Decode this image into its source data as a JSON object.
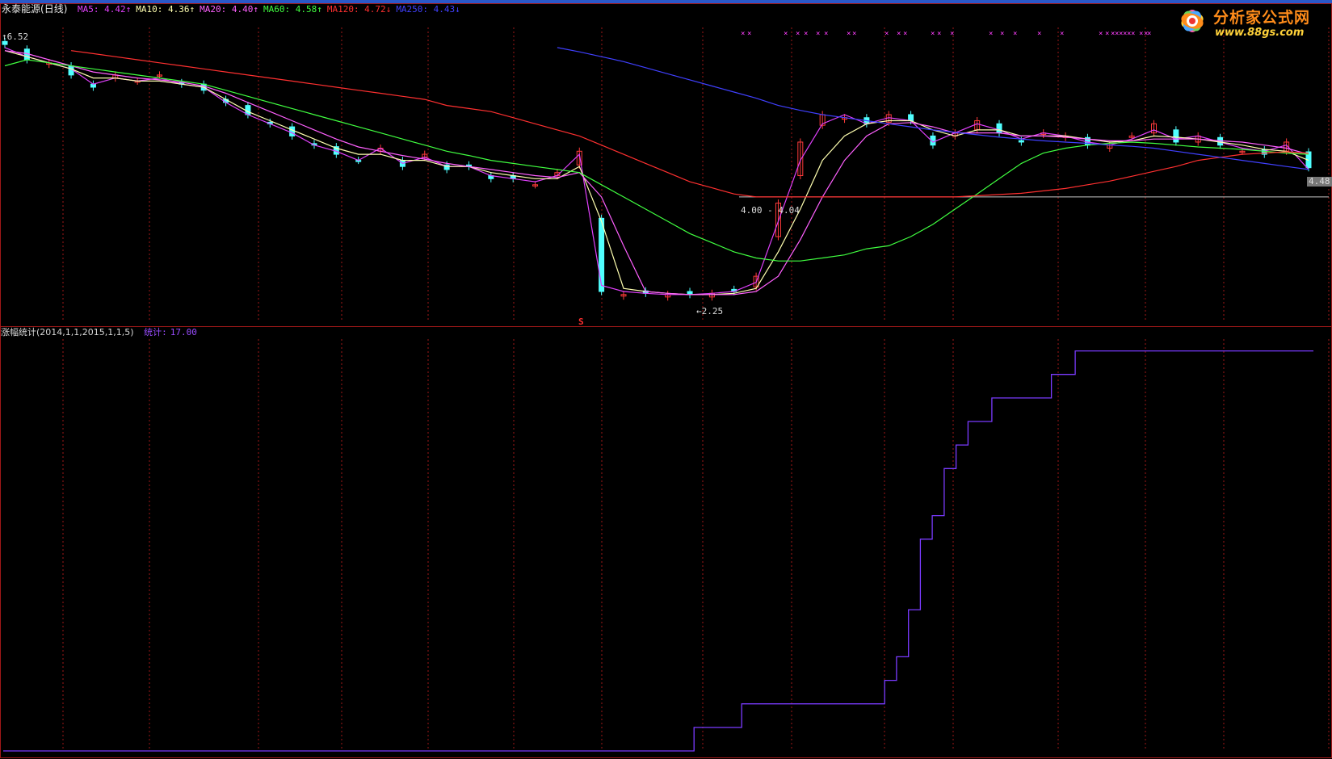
{
  "stock": {
    "name": "永泰能源",
    "period": "(日线)"
  },
  "ma_legend": [
    {
      "label": "MA5",
      "value": "4.42",
      "arrow": "↑",
      "color": "#e040fb"
    },
    {
      "label": "MA10",
      "value": "4.36",
      "arrow": "↑",
      "color": "#ffffb0"
    },
    {
      "label": "MA20",
      "value": "4.40",
      "arrow": "↑",
      "color": "#ff60ff"
    },
    {
      "label": "MA60",
      "value": "4.58",
      "arrow": "↑",
      "color": "#40ff40"
    },
    {
      "label": "MA120",
      "value": "4.72",
      "arrow": "↓",
      "color": "#ff3030"
    },
    {
      "label": "MA250",
      "value": "4.43",
      "arrow": "↓",
      "color": "#4040ff"
    }
  ],
  "price_labels": {
    "high": "6.52",
    "low": "2.25",
    "band": "4.00 - 4.04",
    "last": "4.48",
    "signal": "S"
  },
  "indicator": {
    "title": "涨幅统计",
    "params": "(2014,1,1,2015,1,1,5)",
    "stat_label": "统计:",
    "stat_value": "17.00"
  },
  "logo": {
    "text": "分析家公式网",
    "url": "www.88gs.com"
  },
  "colors": {
    "up": "#ff3b3b",
    "down": "#50ffff",
    "grid": "#a01818",
    "stat_line": "#7a3bff"
  },
  "chart_data": [
    {
      "type": "line",
      "title": "永泰能源(日线)",
      "ylim": [
        2.0,
        6.7
      ],
      "series": [
        {
          "name": "MA5",
          "values": [
            6.45,
            6.3,
            6.2,
            6.1,
            5.85,
            5.95,
            5.9,
            5.95,
            5.85,
            5.8,
            5.55,
            5.35,
            5.2,
            5.05,
            4.85,
            4.75,
            4.6,
            4.8,
            4.55,
            4.65,
            4.5,
            4.5,
            4.35,
            4.3,
            4.25,
            4.35,
            4.7,
            2.55,
            2.45,
            2.42,
            2.4,
            2.4,
            2.42,
            2.45,
            2.6,
            3.6,
            4.6,
            5.2,
            5.35,
            5.2,
            5.3,
            5.25,
            4.9,
            5.05,
            5.2,
            5.1,
            4.95,
            5.05,
            5.0,
            4.9,
            4.85,
            4.95,
            5.1,
            4.95,
            5.0,
            4.9,
            4.8,
            4.75,
            4.85,
            4.45
          ]
        },
        {
          "name": "MA10",
          "values": [
            6.4,
            6.3,
            6.2,
            6.1,
            5.95,
            5.95,
            5.9,
            5.9,
            5.85,
            5.8,
            5.6,
            5.4,
            5.25,
            5.1,
            4.95,
            4.8,
            4.7,
            4.7,
            4.6,
            4.6,
            4.5,
            4.5,
            4.4,
            4.35,
            4.3,
            4.3,
            4.5,
            3.6,
            2.5,
            2.45,
            2.42,
            2.4,
            2.4,
            2.42,
            2.5,
            3.1,
            3.8,
            4.6,
            5.0,
            5.2,
            5.25,
            5.25,
            5.1,
            5.0,
            5.1,
            5.1,
            5.0,
            5.0,
            5.0,
            4.95,
            4.9,
            4.92,
            5.0,
            4.98,
            4.95,
            4.9,
            4.85,
            4.78,
            4.75,
            4.6
          ]
        },
        {
          "name": "MA20",
          "values": [
            6.4,
            6.35,
            6.25,
            6.15,
            6.05,
            6.0,
            5.95,
            5.92,
            5.88,
            5.82,
            5.7,
            5.55,
            5.4,
            5.25,
            5.1,
            4.95,
            4.82,
            4.75,
            4.68,
            4.62,
            4.55,
            4.5,
            4.45,
            4.4,
            4.35,
            4.32,
            4.4,
            4.0,
            3.2,
            2.45,
            2.42,
            2.4,
            2.4,
            2.4,
            2.45,
            2.7,
            3.3,
            4.0,
            4.6,
            5.0,
            5.2,
            5.22,
            5.15,
            5.05,
            5.05,
            5.05,
            5.0,
            5.0,
            4.98,
            4.95,
            4.92,
            4.92,
            4.95,
            4.95,
            4.95,
            4.92,
            4.9,
            4.85,
            4.8,
            4.7
          ]
        },
        {
          "name": "MA60",
          "values": [
            6.15,
            6.25,
            6.2,
            6.15,
            6.1,
            6.05,
            6.0,
            5.95,
            5.9,
            5.85,
            5.75,
            5.65,
            5.55,
            5.45,
            5.35,
            5.25,
            5.15,
            5.05,
            4.95,
            4.85,
            4.75,
            4.68,
            4.6,
            4.55,
            4.5,
            4.45,
            4.4,
            4.2,
            4.0,
            3.8,
            3.6,
            3.4,
            3.25,
            3.1,
            3.0,
            2.95,
            2.95,
            3.0,
            3.05,
            3.15,
            3.2,
            3.35,
            3.55,
            3.8,
            4.05,
            4.3,
            4.55,
            4.72,
            4.8,
            4.85,
            4.88,
            4.9,
            4.88,
            4.85,
            4.82,
            4.8,
            4.78,
            4.75,
            4.72,
            4.7
          ]
        },
        {
          "name": "MA120",
          "values": [
            null,
            null,
            null,
            6.4,
            6.35,
            6.3,
            6.25,
            6.2,
            6.15,
            6.1,
            6.05,
            6.0,
            5.95,
            5.9,
            5.85,
            5.8,
            5.75,
            5.7,
            5.65,
            5.6,
            5.5,
            5.45,
            5.4,
            5.3,
            5.2,
            5.1,
            5.0,
            4.85,
            4.7,
            4.55,
            4.4,
            4.25,
            4.15,
            4.05,
            4.0,
            4.0,
            4.0,
            4.0,
            4.0,
            4.0,
            4.0,
            4.0,
            4.0,
            4.0,
            4.02,
            4.04,
            4.06,
            4.1,
            4.14,
            4.2,
            4.26,
            4.34,
            4.42,
            4.5,
            4.6,
            4.65,
            4.7,
            4.72,
            4.74,
            4.72
          ]
        },
        {
          "name": "MA250",
          "values": [
            null,
            null,
            null,
            null,
            null,
            null,
            null,
            null,
            null,
            null,
            null,
            null,
            null,
            null,
            null,
            null,
            null,
            null,
            null,
            null,
            null,
            null,
            null,
            null,
            null,
            6.45,
            6.38,
            6.3,
            6.22,
            6.12,
            6.02,
            5.92,
            5.82,
            5.72,
            5.62,
            5.5,
            5.42,
            5.35,
            5.3,
            5.25,
            5.2,
            5.15,
            5.1,
            5.06,
            5.02,
            4.98,
            4.95,
            4.92,
            4.9,
            4.88,
            4.85,
            4.83,
            4.8,
            4.75,
            4.7,
            4.65,
            4.6,
            4.55,
            4.5,
            4.45
          ]
        },
        {
          "name": "K",
          "values": [
            6.5,
            6.25,
            6.2,
            6.0,
            5.8,
            6.0,
            5.9,
            6.0,
            5.85,
            5.75,
            5.55,
            5.35,
            5.2,
            5.0,
            4.85,
            4.7,
            4.6,
            4.8,
            4.5,
            4.7,
            4.45,
            4.5,
            4.3,
            4.3,
            4.2,
            4.4,
            4.75,
            2.45,
            2.4,
            2.42,
            2.4,
            2.4,
            2.42,
            2.45,
            2.7,
            3.9,
            4.9,
            5.35,
            5.3,
            5.2,
            5.35,
            5.25,
            4.85,
            5.05,
            5.25,
            5.05,
            4.9,
            5.05,
            5.0,
            4.85,
            4.85,
            5.0,
            5.2,
            4.9,
            5.0,
            4.85,
            4.75,
            4.7,
            4.9,
            4.48
          ]
        }
      ]
    },
    {
      "type": "line",
      "title": "涨幅统计",
      "ylim": [
        0,
        17.5
      ],
      "series": [
        {
          "name": "统计",
          "values": [
            0,
            0,
            0,
            0,
            0,
            0,
            0,
            0,
            0,
            0,
            0,
            0,
            0,
            0,
            0,
            0,
            0,
            0,
            0,
            0,
            0,
            0,
            0,
            0,
            0,
            0,
            0,
            0,
            0,
            0,
            0,
            0,
            0,
            0,
            0,
            0,
            0,
            0,
            0,
            0,
            0,
            0,
            0,
            0,
            0,
            0,
            0,
            0,
            0,
            0,
            0,
            0,
            0,
            0,
            0,
            0,
            0,
            0,
            1,
            1,
            1,
            1,
            2,
            2,
            2,
            2,
            2,
            2,
            2,
            2,
            2,
            2,
            2,
            2,
            3,
            4,
            6,
            9,
            10,
            12,
            13,
            14,
            14,
            15,
            15,
            15,
            15,
            15,
            16,
            16,
            17,
            17,
            17,
            17,
            17,
            17,
            17,
            17,
            17,
            17,
            17,
            17,
            17,
            17,
            17,
            17,
            17,
            17,
            17,
            17,
            17
          ]
        }
      ]
    }
  ]
}
